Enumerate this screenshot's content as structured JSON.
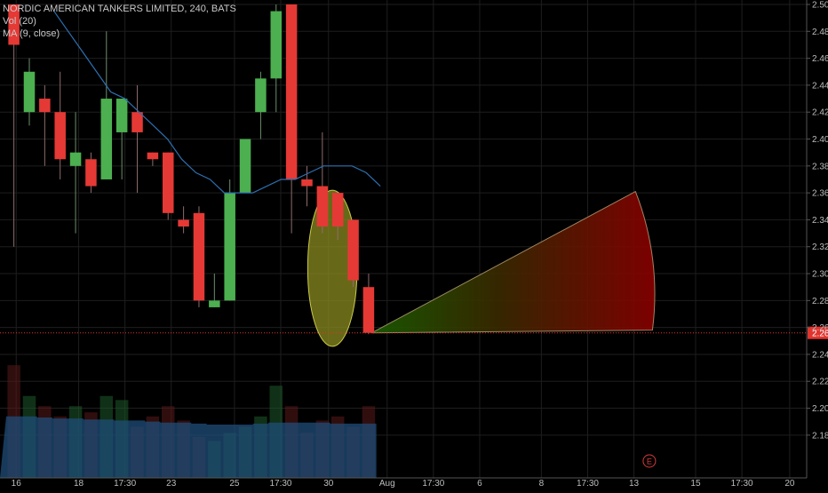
{
  "legend": {
    "symbol_line": "NORDIC AMERICAN TANKERS LIMITED, 240, BATS",
    "vol_line": "Vol (20)",
    "ma_line": "MA (9, close)"
  },
  "event_marker": {
    "label": "E",
    "x_index": 41.2
  },
  "current_price": {
    "label": "2.26",
    "value": 2.256,
    "color": "#e0342f"
  },
  "colors": {
    "up": "#4caf50",
    "down": "#e53935",
    "ma": "#2d6fb0",
    "vol_area": "#1f4e7a",
    "ellipse_fill": "#8b8b22",
    "axis_text": "#bdbdbd",
    "grid": "#1e1e1e"
  },
  "chart_data": {
    "type": "candlestick",
    "title": "NORDIC AMERICAN TANKERS LIMITED, 240, BATS",
    "ylim": [
      2.17,
      2.5
    ],
    "y_ticks": [
      "2.50",
      "2.48",
      "2.46",
      "2.44",
      "2.42",
      "2.40",
      "2.38",
      "2.36",
      "2.34",
      "2.32",
      "2.30",
      "2.28",
      "2.26",
      "2.24",
      "2.22",
      "2.20",
      "2.18"
    ],
    "x_range": [
      -0.9,
      51.4
    ],
    "x_ticks": [
      {
        "label": "16",
        "index": 0.15
      },
      {
        "label": "18",
        "index": 4.2
      },
      {
        "label": "17:30",
        "index": 7.2
      },
      {
        "label": "23",
        "index": 10.2
      },
      {
        "label": "25",
        "index": 14.3
      },
      {
        "label": "17:30",
        "index": 17.3
      },
      {
        "label": "30",
        "index": 20.4
      },
      {
        "label": "Aug",
        "index": 24.2
      },
      {
        "label": "17:30",
        "index": 27.2
      },
      {
        "label": "6",
        "index": 30.2
      },
      {
        "label": "8",
        "index": 34.2
      },
      {
        "label": "17:30",
        "index": 37.2
      },
      {
        "label": "13",
        "index": 40.2
      },
      {
        "label": "15",
        "index": 44.2
      },
      {
        "label": "17:30",
        "index": 47.2
      },
      {
        "label": "20",
        "index": 50.3
      }
    ],
    "candles": [
      {
        "o": 2.5,
        "h": 2.5,
        "l": 2.32,
        "c": 2.47
      },
      {
        "o": 2.42,
        "h": 2.46,
        "l": 2.41,
        "c": 2.45
      },
      {
        "o": 2.43,
        "h": 2.44,
        "l": 2.38,
        "c": 2.42
      },
      {
        "o": 2.42,
        "h": 2.45,
        "l": 2.37,
        "c": 2.385
      },
      {
        "o": 2.38,
        "h": 2.42,
        "l": 2.33,
        "c": 2.39
      },
      {
        "o": 2.385,
        "h": 2.39,
        "l": 2.36,
        "c": 2.365
      },
      {
        "o": 2.37,
        "h": 2.48,
        "l": 2.37,
        "c": 2.43
      },
      {
        "o": 2.405,
        "h": 2.43,
        "l": 2.37,
        "c": 2.43
      },
      {
        "o": 2.42,
        "h": 2.44,
        "l": 2.36,
        "c": 2.405
      },
      {
        "o": 2.39,
        "h": 2.39,
        "l": 2.38,
        "c": 2.385
      },
      {
        "o": 2.39,
        "h": 2.39,
        "l": 2.34,
        "c": 2.345
      },
      {
        "o": 2.34,
        "h": 2.35,
        "l": 2.33,
        "c": 2.335
      },
      {
        "o": 2.345,
        "h": 2.35,
        "l": 2.275,
        "c": 2.28
      },
      {
        "o": 2.275,
        "h": 2.3,
        "l": 2.275,
        "c": 2.28
      },
      {
        "o": 2.28,
        "h": 2.37,
        "l": 2.28,
        "c": 2.36
      },
      {
        "o": 2.36,
        "h": 2.4,
        "l": 2.36,
        "c": 2.4
      },
      {
        "o": 2.42,
        "h": 2.45,
        "l": 2.4,
        "c": 2.445
      },
      {
        "o": 2.445,
        "h": 2.5,
        "l": 2.42,
        "c": 2.495
      },
      {
        "o": 2.5,
        "h": 2.5,
        "l": 2.33,
        "c": 2.37
      },
      {
        "o": 2.37,
        "h": 2.38,
        "l": 2.35,
        "c": 2.365
      },
      {
        "o": 2.365,
        "h": 2.405,
        "l": 2.33,
        "c": 2.335
      },
      {
        "o": 2.36,
        "h": 2.36,
        "l": 2.325,
        "c": 2.335
      },
      {
        "o": 2.34,
        "h": 2.34,
        "l": 2.29,
        "c": 2.295
      },
      {
        "o": 2.29,
        "h": 2.3,
        "l": 2.255,
        "c": 2.256
      }
    ],
    "ma": {
      "name": "MA (9, close)",
      "start_index": 2.6,
      "values": [
        2.495,
        2.48,
        2.465,
        2.45,
        2.435,
        2.43,
        2.42,
        2.41,
        2.4,
        2.385,
        2.375,
        2.37,
        2.36,
        2.36,
        2.36,
        2.365,
        2.37,
        2.37,
        2.375,
        2.38,
        2.38,
        2.38,
        2.375,
        2.365
      ]
    },
    "volume": {
      "name": "Vol (20)",
      "bars": [
        0.55,
        0.4,
        0.35,
        0.3,
        0.35,
        0.32,
        0.4,
        0.38,
        0.25,
        0.3,
        0.35,
        0.28,
        0.2,
        0.18,
        0.22,
        0.25,
        0.3,
        0.45,
        0.35,
        0.22,
        0.28,
        0.3,
        0.25,
        0.35
      ],
      "avg": [
        0.3,
        0.3,
        0.295,
        0.29,
        0.29,
        0.285,
        0.285,
        0.28,
        0.28,
        0.275,
        0.27,
        0.27,
        0.265,
        0.26,
        0.26,
        0.26,
        0.265,
        0.27,
        0.27,
        0.27,
        0.27,
        0.265,
        0.265,
        0.265
      ],
      "max": 0.62
    },
    "annotations": {
      "ellipse": {
        "cx": 20.65,
        "cy": 2.304,
        "rx": 1.6,
        "ry": 0.058
      },
      "fan": {
        "origin": {
          "x": 23.2,
          "y": 2.256
        },
        "upper": {
          "x": 40.3,
          "y": 2.361
        },
        "lower": {
          "x": 41.4,
          "y": 2.258
        }
      }
    }
  }
}
